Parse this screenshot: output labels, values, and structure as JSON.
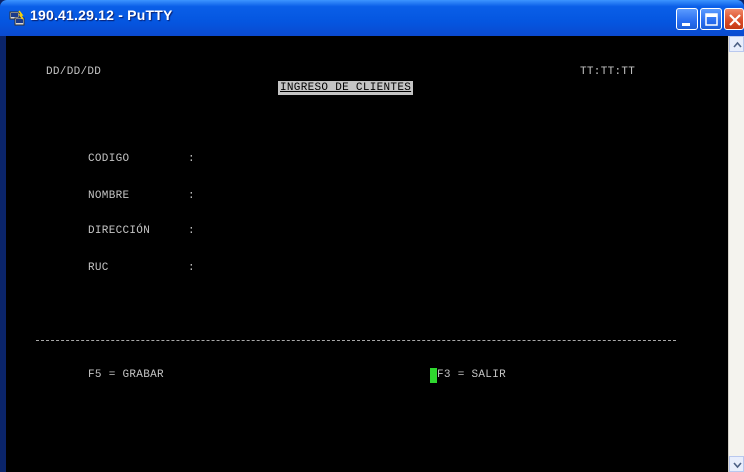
{
  "window": {
    "title": "190.41.29.12 - PuTTY",
    "titlebar_color": "#0556e0"
  },
  "terminal": {
    "date": "DD/DD/DD",
    "time": "TT:TT:TT",
    "screen_title": "INGRESO DE CLIENTES",
    "fields": [
      {
        "label": "CODIGO",
        "colon": ":"
      },
      {
        "label": "NOMBRE",
        "colon": ":"
      },
      {
        "label": "DIRECCIÓN",
        "colon": ":"
      },
      {
        "label": "RUC",
        "colon": ":"
      }
    ],
    "f5_label": "F5 = GRABAR",
    "f3_label": "F3 = SALIR",
    "cursor_color": "#2fd82f"
  },
  "icons": {
    "app": "putty-icon",
    "minimize": "minimize-icon",
    "maximize": "maximize-icon",
    "close": "close-icon"
  }
}
